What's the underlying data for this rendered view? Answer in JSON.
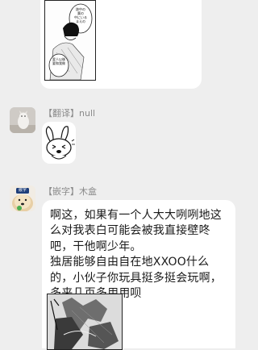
{
  "messages": [
    {
      "type": "image",
      "description": "manga-panel"
    },
    {
      "sender": "【翻译】null",
      "type": "sticker"
    },
    {
      "sender": "【嵌字】木盒",
      "type": "text",
      "text": "啊这，如果有一个人大大咧咧地这么对我表白可能会被我直接壁咚吧，干他啊少年。\n独居能够自由自在地XXOO什么的，小伙子你玩具挺多挺会玩啊，多来几页多用用呗"
    }
  ],
  "manga_top": {
    "speech1": "鉢中の\n葉の\n中にいる\nまえの",
    "speech2": "愛人以後\n要和我做"
  },
  "avatar2": {
    "label": "嵌字"
  }
}
